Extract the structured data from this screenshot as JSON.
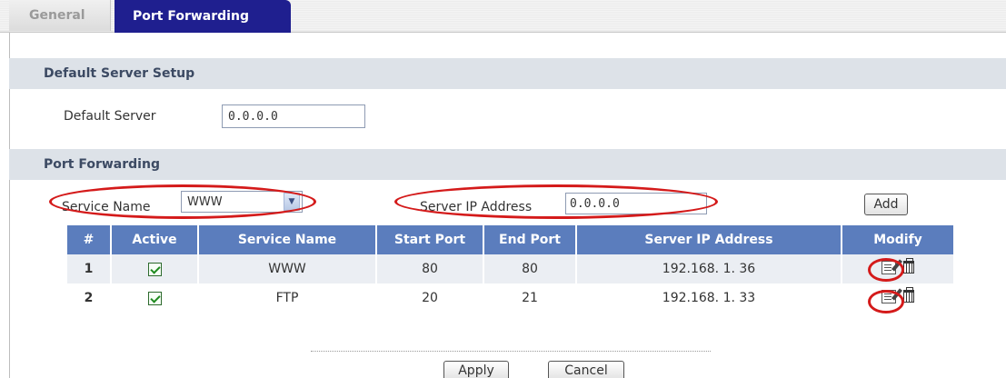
{
  "tabs": [
    {
      "label": "General",
      "active": false
    },
    {
      "label": "Port Forwarding",
      "active": true
    }
  ],
  "default_server_section": {
    "title": "Default Server Setup",
    "field_label": "Default Server",
    "field_value": "0.0.0.0"
  },
  "port_forwarding_section": {
    "title": "Port Forwarding",
    "service_name_label": "Service Name",
    "service_name_selected": "WWW",
    "server_ip_label": "Server IP Address",
    "server_ip_value": "0.0.0.0",
    "add_label": "Add"
  },
  "table": {
    "headers": [
      "#",
      "Active",
      "Service Name",
      "Start Port",
      "End Port",
      "Server IP Address",
      "Modify"
    ],
    "rows": [
      {
        "num": "1",
        "active": true,
        "service": "WWW",
        "start": "80",
        "end": "80",
        "ip": "192.168. 1. 36"
      },
      {
        "num": "2",
        "active": true,
        "service": "FTP",
        "start": "20",
        "end": "21",
        "ip": "192.168. 1. 33"
      }
    ]
  },
  "buttons": {
    "apply": "Apply",
    "cancel": "Cancel"
  },
  "icons": {
    "edit": "edit-icon",
    "delete": "trash-icon",
    "checkbox": "checkbox-checked-icon",
    "dropdown": "chevron-down-icon"
  },
  "colors": {
    "tab_active_bg": "#1f1f8f",
    "table_header_bg": "#5b7dbd",
    "section_band_bg": "#dde2e8",
    "annotation_red": "#d41a1a"
  }
}
